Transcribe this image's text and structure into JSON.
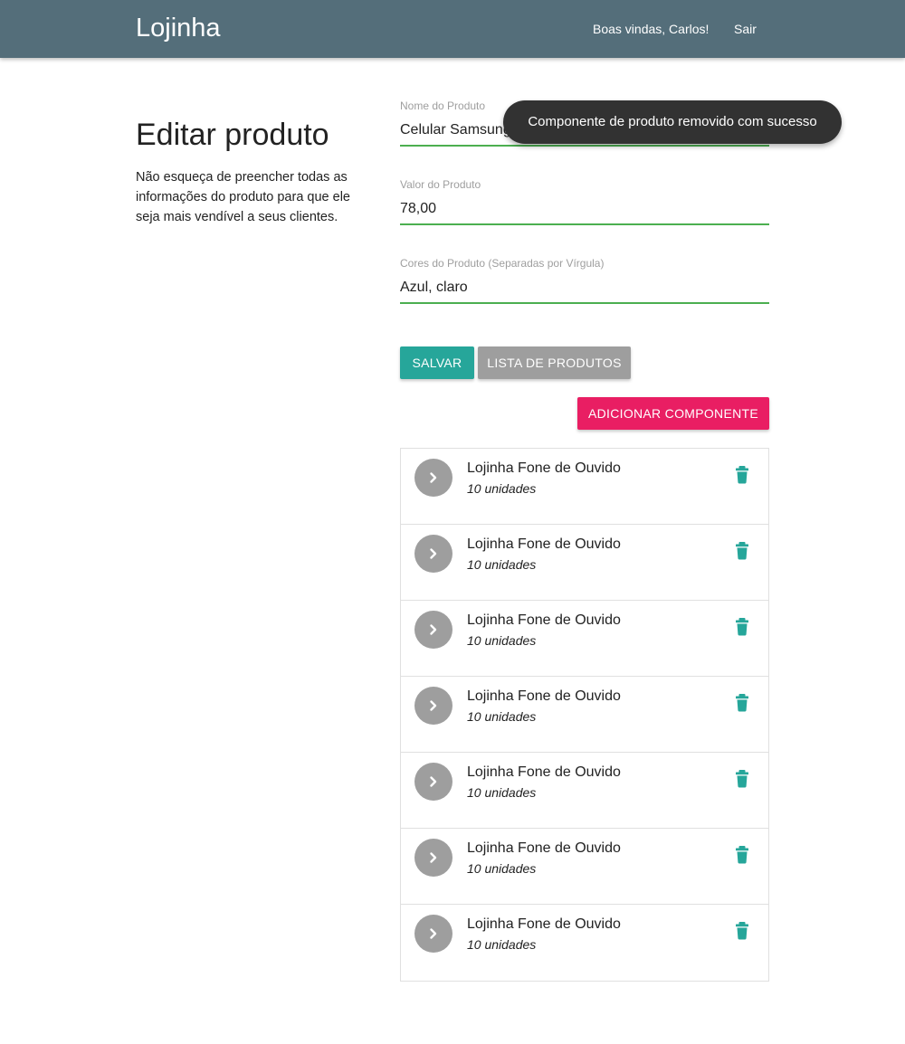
{
  "navbar": {
    "brand": "Lojinha",
    "greeting": "Boas vindas, Carlos!",
    "logout": "Sair",
    "color": "#546e7a"
  },
  "intro": {
    "title": "Editar produto",
    "description": "Não esqueça de preencher todas as informações do produto para que ele seja mais vendível a seus clientes."
  },
  "form": {
    "name": {
      "label": "Nome do Produto",
      "value": "Celular Samsung"
    },
    "price": {
      "label": "Valor do Produto",
      "value": "78,00"
    },
    "colors": {
      "label": "Cores do Produto (Separadas por Vírgula)",
      "value": "Azul, claro"
    }
  },
  "buttons": {
    "save": "SALVAR",
    "list": "LISTA DE PRODUTOS",
    "add_component": "ADICIONAR COMPONENTE"
  },
  "components": [
    {
      "name": "Lojinha Fone de Ouvido",
      "quantity": "10 unidades"
    },
    {
      "name": "Lojinha Fone de Ouvido",
      "quantity": "10 unidades"
    },
    {
      "name": "Lojinha Fone de Ouvido",
      "quantity": "10 unidades"
    },
    {
      "name": "Lojinha Fone de Ouvido",
      "quantity": "10 unidades"
    },
    {
      "name": "Lojinha Fone de Ouvido",
      "quantity": "10 unidades"
    },
    {
      "name": "Lojinha Fone de Ouvido",
      "quantity": "10 unidades"
    },
    {
      "name": "Lojinha Fone de Ouvido",
      "quantity": "10 unidades"
    }
  ],
  "toast": {
    "message": "Componente de produto removido com sucesso"
  },
  "colors": {
    "accent_teal": "#26a69a",
    "accent_pink": "#e91e63",
    "input_underline": "#4caf50",
    "neutral_grey": "#9e9e9e"
  },
  "icons": {
    "avatar": "chevron-right-icon",
    "delete": "trash-icon"
  }
}
